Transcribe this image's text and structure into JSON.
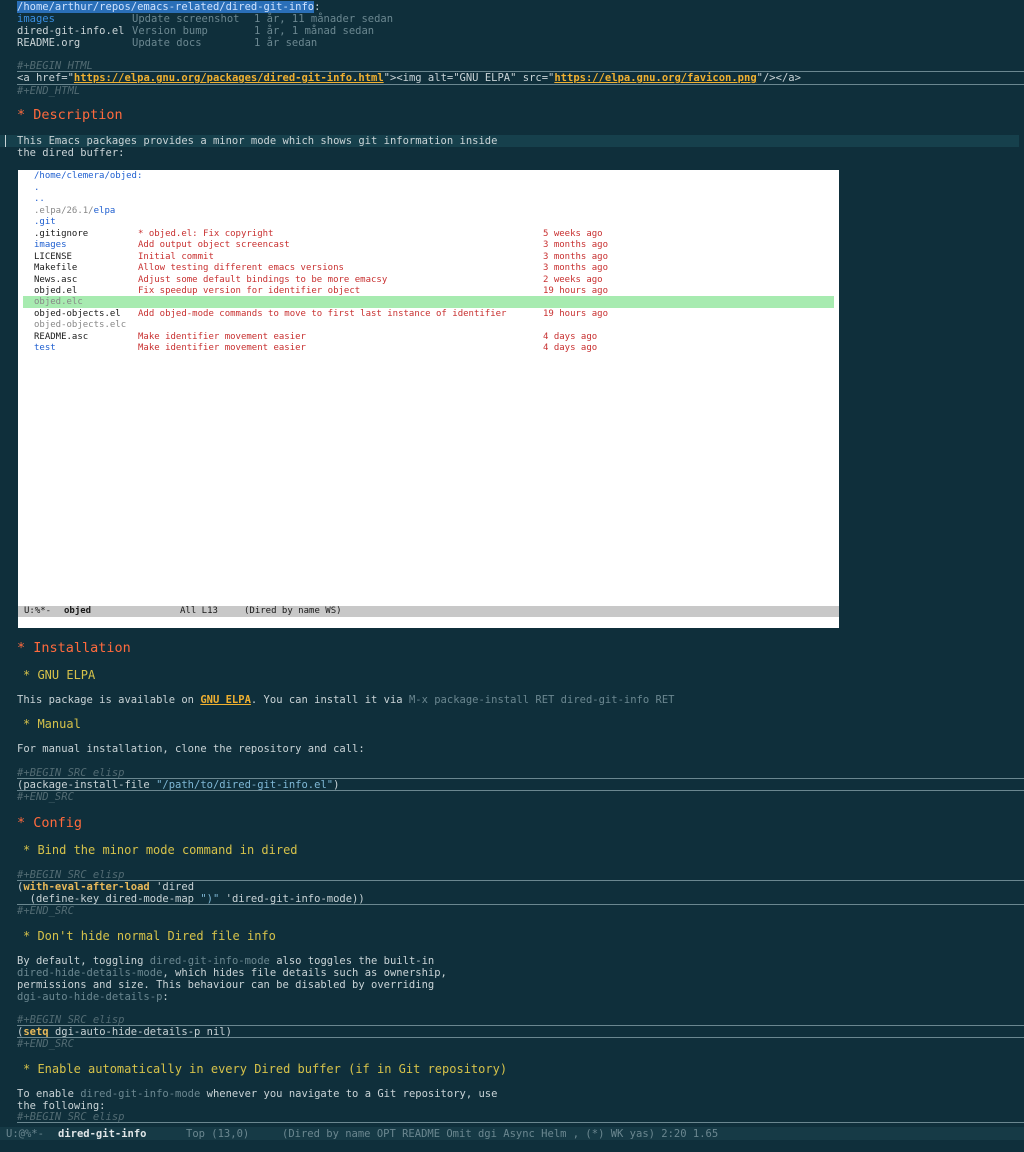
{
  "header": {
    "path": "/home/arthur/repos/emacs-related/dired-git-info",
    "path_suffix": ":",
    "rows": [
      {
        "name": "images",
        "msg": "Update screenshot",
        "age": "1 år, 11 månader sedan"
      },
      {
        "name": "dired-git-info.el",
        "msg": "Version bump",
        "age": "1 år, 1 månad sedan"
      },
      {
        "name": "README.org",
        "msg": "Update docs",
        "age": "1 år sedan"
      }
    ]
  },
  "html_block": {
    "begin": "#+BEGIN_HTML",
    "line_pre": "<a href=\"",
    "href": "https://elpa.gnu.org/packages/dired-git-info.html",
    "line_mid": "\"><img alt=\"GNU ELPA\" src=\"",
    "src": "https://elpa.gnu.org/favicon.png",
    "line_post": "\"/></a>",
    "end": "#+END_HTML"
  },
  "description": {
    "heading": "* Description",
    "text1": "This Emacs packages provides a minor mode which shows git information inside",
    "text2": "the dired buffer:"
  },
  "screenshot": {
    "path_prefix": "/home/clemera/objed:",
    "dot": ".",
    "dotdot": "..",
    "elpa_prefix": ".elpa/26.1/",
    "elpa_dir": "elpa",
    "git": ".git",
    "rows": [
      {
        "name": ".gitignore",
        "msg": "* objed.el: Fix copyright",
        "age": "5 weeks ago"
      },
      {
        "name": "images",
        "msg": "Add output object screencast",
        "age": "3 months ago"
      },
      {
        "name": "LICENSE",
        "msg": "Initial commit",
        "age": "3 months ago"
      },
      {
        "name": "Makefile",
        "msg": "Allow testing different emacs versions",
        "age": "3 months ago"
      },
      {
        "name": "News.asc",
        "msg": "Adjust some default bindings to be more emacsy",
        "age": "2 weeks ago"
      },
      {
        "name": "objed.el",
        "msg": "Fix speedup version for identifier object",
        "age": "19 hours ago"
      },
      {
        "name": "objed.elc",
        "msg": "",
        "age": ""
      },
      {
        "name": "objed-objects.el",
        "msg": "Add objed-mode commands to move to first last instance of identifier",
        "age": "19 hours ago"
      },
      {
        "name": "objed-objects.elc",
        "msg": "",
        "age": ""
      },
      {
        "name": "README.asc",
        "msg": "Make identifier movement easier",
        "age": "4 days ago"
      },
      {
        "name": "test",
        "msg": "Make identifier movement easier",
        "age": "4 days ago"
      }
    ],
    "modeline_left": "U:%*-  ",
    "modeline_buf": "objed",
    "modeline_pos": "All L13",
    "modeline_mode": "(Dired by name WS)"
  },
  "installation": {
    "heading": "* Installation",
    "gnu_heading": "* GNU ELPA",
    "gnu_text_pre": "This package is available on ",
    "gnu_link": "GNU ELPA",
    "gnu_text_post": ". You can install it via ",
    "gnu_cmd": "M-x package-install RET dired-git-info RET",
    "manual_heading": "* Manual",
    "manual_text": "For manual installation, clone the repository and call:",
    "src_begin": "#+BEGIN_SRC elisp",
    "src_line_pre": "(package-install-file ",
    "src_line_str": "\"/path/to/dired-git-info.el\"",
    "src_line_post": ")",
    "src_end": "#+END_SRC"
  },
  "config": {
    "heading": "* Config",
    "bind_heading": "* Bind the minor mode command in dired",
    "bind_begin": "#+BEGIN_SRC elisp",
    "bind_l1_pre": "(",
    "bind_l1_kw": "with-eval-after-load",
    "bind_l1_post": " 'dired",
    "bind_l2_pre": "  (define-key dired-mode-map ",
    "bind_l2_str": "\")\"",
    "bind_l2_post": " 'dired-git-info-mode))",
    "bind_end": "#+END_SRC",
    "hide_heading": "* Don't hide normal Dired file info",
    "hide_l1_pre": "By default, toggling ",
    "hide_l1_code": "dired-git-info-mode",
    "hide_l1_post": " also toggles the built-in",
    "hide_l2_code": "dired-hide-details-mode",
    "hide_l2_post": ", which hides file details such as ownership,",
    "hide_l3": "permissions and size. This behaviour can be disabled by overriding",
    "hide_l4_code": "dgi-auto-hide-details-p",
    "hide_l4_post": ":",
    "hide_begin": "#+BEGIN_SRC elisp",
    "hide_src_pre": "(",
    "hide_src_kw": "setq",
    "hide_src_post": " dgi-auto-hide-details-p nil)",
    "hide_end": "#+END_SRC",
    "auto_heading": "* Enable automatically in every Dired buffer (if in Git repository)",
    "auto_l1_pre": "To enable ",
    "auto_l1_code": "dired-git-info-mode",
    "auto_l1_post": " whenever you navigate to a Git repository, use",
    "auto_l2": "the following:",
    "auto_begin": "#+BEGIN_SRC elisp"
  },
  "modeline": {
    "left": "U:@%*-  ",
    "buffer": "dired-git-info",
    "pos": "Top (13,0)",
    "modes": "(Dired by name OPT README Omit dgi Async Helm , (*) WK yas) 2:20 1.65"
  }
}
